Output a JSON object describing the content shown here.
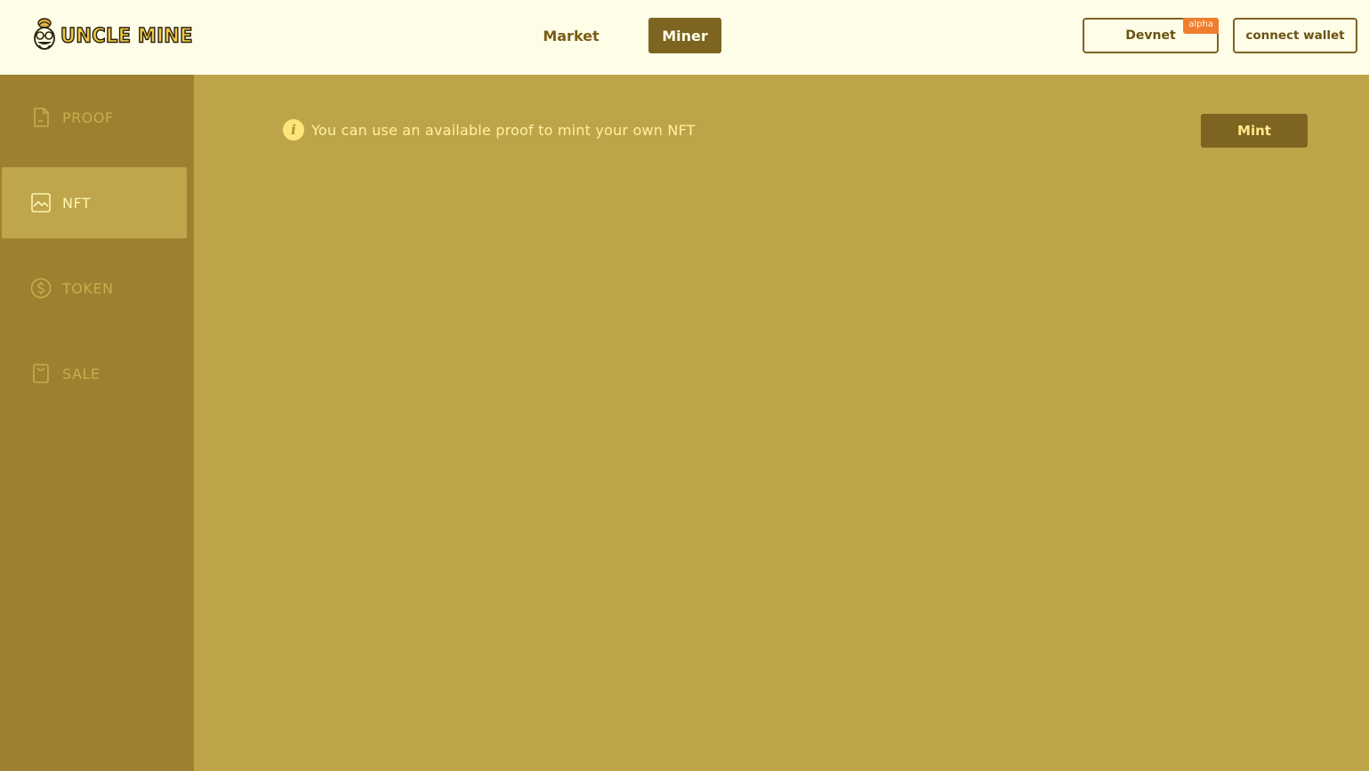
{
  "header": {
    "logo_text": "UNCLE MINE",
    "nav": [
      {
        "label": "Market",
        "active": false
      },
      {
        "label": "Miner",
        "active": true
      }
    ],
    "network_button": {
      "label": "Devnet",
      "badge": "alpha"
    },
    "wallet_button": {
      "label": "connect wallet"
    }
  },
  "sidebar": {
    "items": [
      {
        "label": "PROOF",
        "icon": "document-icon",
        "active": false
      },
      {
        "label": "NFT",
        "icon": "image-icon",
        "active": true
      },
      {
        "label": "TOKEN",
        "icon": "coin-icon",
        "active": false
      },
      {
        "label": "SALE",
        "icon": "bag-icon",
        "active": false
      }
    ]
  },
  "main": {
    "info_icon": "info-icon",
    "info_text": "You can use an available proof to mint your own NFT",
    "mint_label": "Mint"
  },
  "colors": {
    "header_bg": "#fdfde8",
    "sidebar_bg": "#9f8030",
    "main_bg": "#bea449",
    "primary_button": "#7d6420",
    "badge": "#ef7d2d"
  }
}
